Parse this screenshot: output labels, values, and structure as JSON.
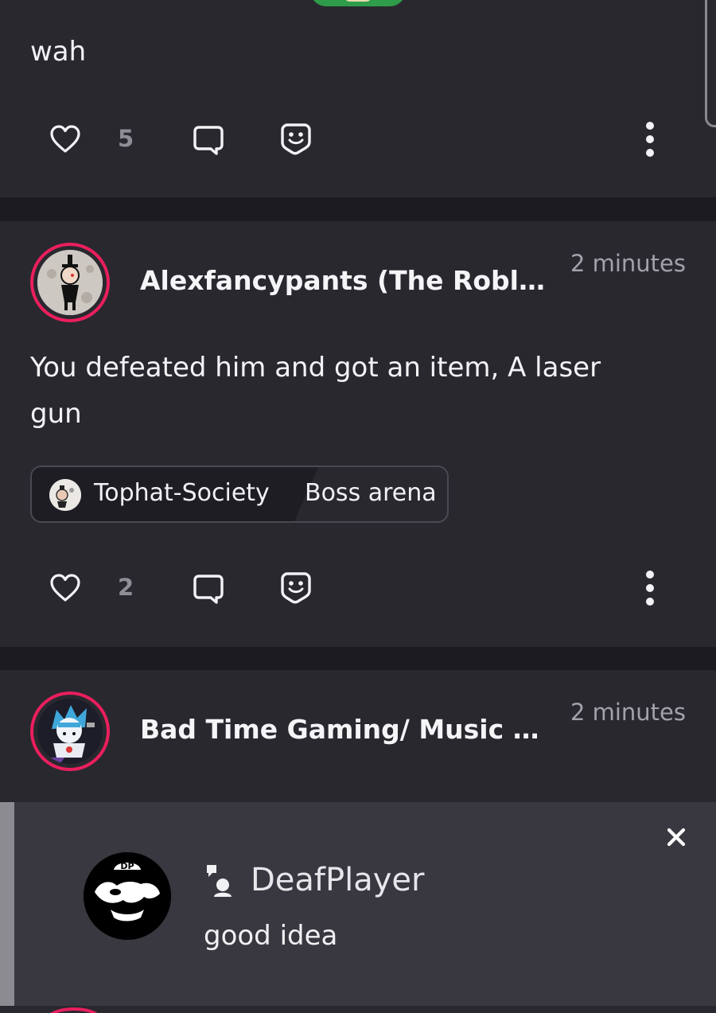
{
  "posts": [
    {
      "text": "wah",
      "likes": "5"
    },
    {
      "author": "Alexfancypants (The Roblo...",
      "time": "2 minutes",
      "text": "You defeated him and got an item, A laser gun",
      "community": "Tophat-Society",
      "topic": "Boss arena",
      "likes": "2"
    },
    {
      "author": "Bad Time Gaming/ Music",
      "handle": "@...",
      "time": "2 minutes"
    }
  ],
  "notification": {
    "sender": "DeafPlayer",
    "message": "good idea",
    "avatar_text": "DP"
  },
  "colors": {
    "background": "#1c1b21",
    "card": "#29282f",
    "accent_ring": "#ea1f5d",
    "toast": "#393840"
  },
  "icons": [
    "heart-icon",
    "comment-icon",
    "sticker-icon",
    "more-vertical-icon",
    "close-icon",
    "chat-bubble-icon"
  ]
}
